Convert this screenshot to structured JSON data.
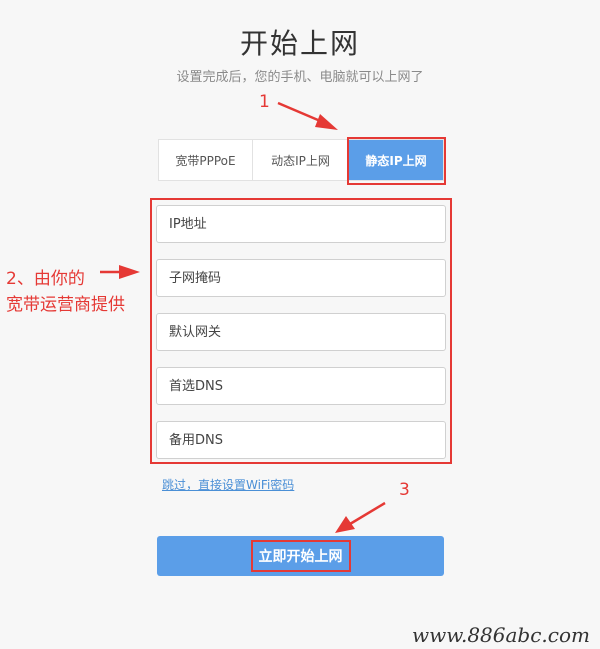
{
  "header": {
    "title": "开始上网",
    "subtitle": "设置完成后，您的手机、电脑就可以上网了"
  },
  "tabs": [
    {
      "label": "宽带PPPoE",
      "active": false
    },
    {
      "label": "动态IP上网",
      "active": false
    },
    {
      "label": "静态IP上网",
      "active": true
    }
  ],
  "form": {
    "ip_placeholder": "IP地址",
    "mask_placeholder": "子网掩码",
    "gateway_placeholder": "默认网关",
    "dns1_placeholder": "首选DNS",
    "dns2_placeholder": "备用DNS"
  },
  "skip_link": "跳过，直接设置WiFi密码",
  "start_button": "立即开始上网",
  "annotations": {
    "n1": "1",
    "n2_line1": "2、由你的",
    "n2_line2": "宽带运营商提供",
    "n3": "3"
  },
  "watermark": "www.886abc.com",
  "colors": {
    "accent": "#5b9ee8",
    "annotation": "#e53935",
    "link": "#4a8fd6"
  }
}
